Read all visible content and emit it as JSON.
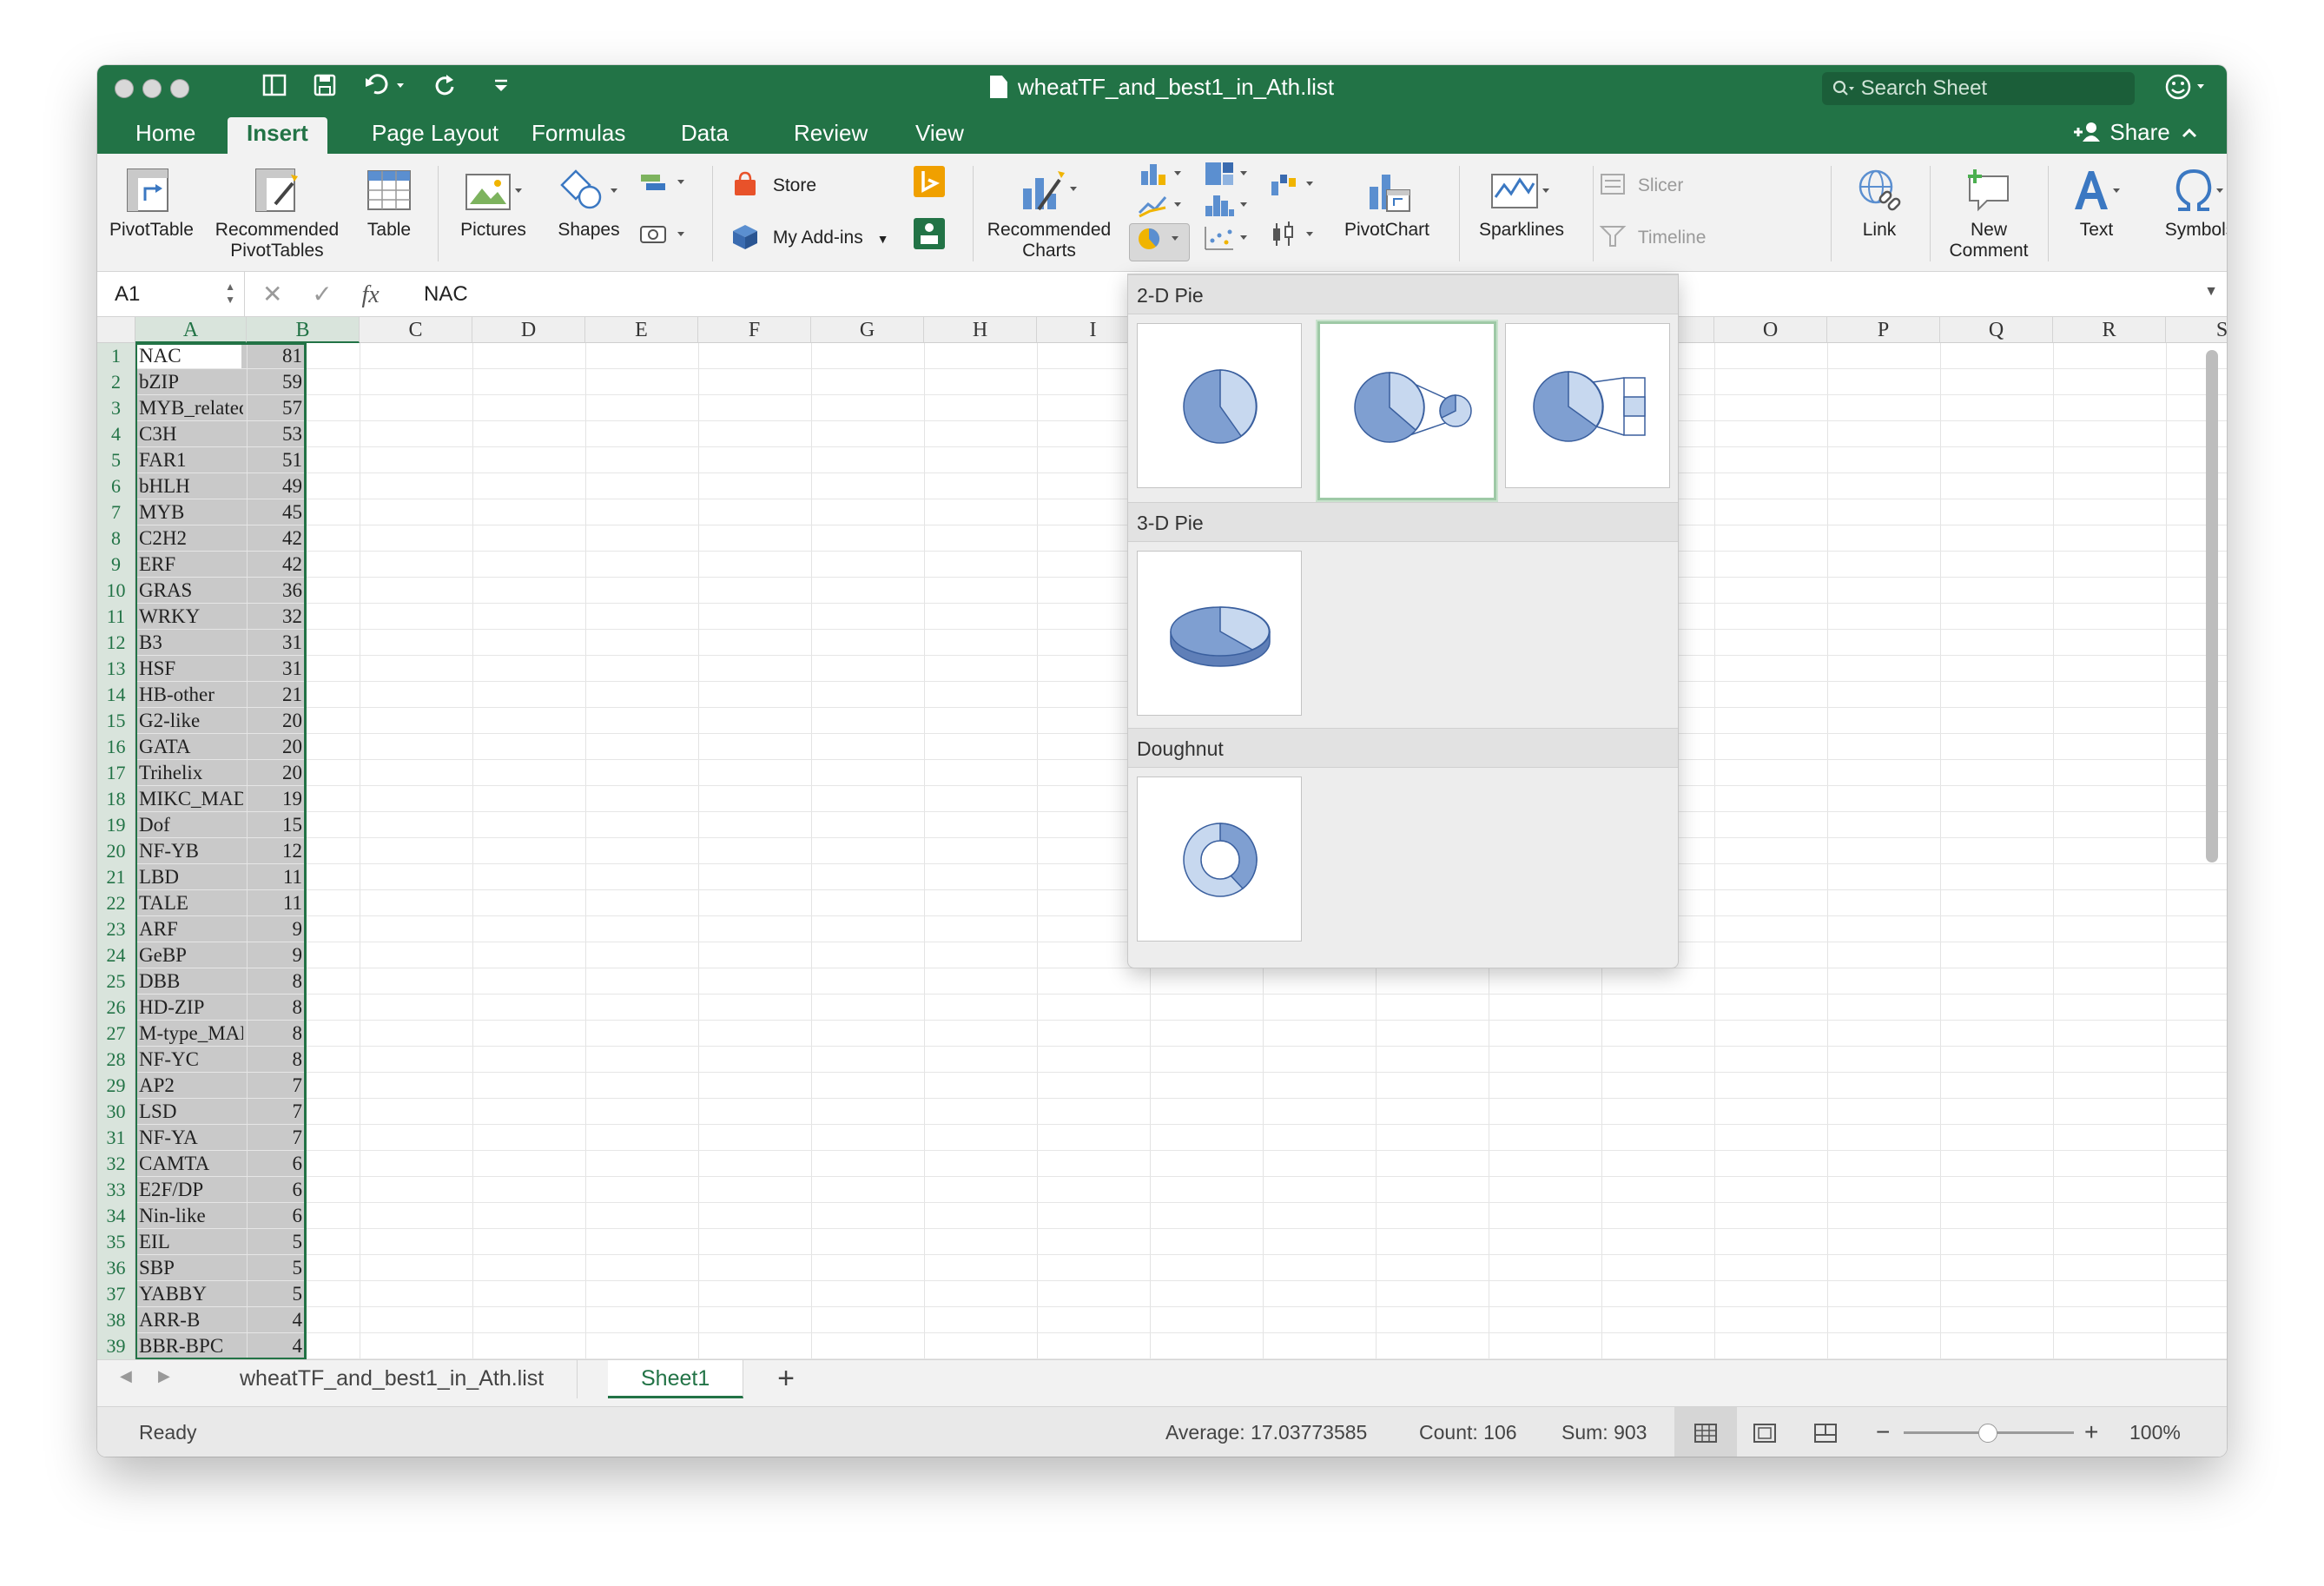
{
  "window": {
    "title": "wheatTF_and_best1_in_Ath.list",
    "search_placeholder": "Search Sheet",
    "share_label": "Share"
  },
  "tabs": [
    "Home",
    "Insert",
    "Page Layout",
    "Formulas",
    "Data",
    "Review",
    "View"
  ],
  "active_tab": "Insert",
  "ribbon": {
    "pivottable": "PivotTable",
    "recommended_pivottables_1": "Recommended",
    "recommended_pivottables_2": "PivotTables",
    "table": "Table",
    "pictures": "Pictures",
    "shapes": "Shapes",
    "store": "Store",
    "my_addins": "My Add-ins",
    "recommended_charts_1": "Recommended",
    "recommended_charts_2": "Charts",
    "pivotchart": "PivotChart",
    "sparklines": "Sparklines",
    "slicer": "Slicer",
    "timeline": "Timeline",
    "link": "Link",
    "new_comment_1": "New",
    "new_comment_2": "Comment",
    "text": "Text",
    "symbols": "Symbols"
  },
  "formula_bar": {
    "name_box": "A1",
    "fx": "fx",
    "value": "NAC"
  },
  "columns": [
    "A",
    "B",
    "C",
    "D",
    "E",
    "F",
    "G",
    "H",
    "I",
    "",
    "",
    "",
    "",
    "",
    "O",
    "P",
    "Q",
    "R",
    "S"
  ],
  "rows": [
    {
      "n": "1",
      "a": "NAC",
      "b": "81"
    },
    {
      "n": "2",
      "a": "bZIP",
      "b": "59"
    },
    {
      "n": "3",
      "a": "MYB_related",
      "b": "57"
    },
    {
      "n": "4",
      "a": "C3H",
      "b": "53"
    },
    {
      "n": "5",
      "a": "FAR1",
      "b": "51"
    },
    {
      "n": "6",
      "a": "bHLH",
      "b": "49"
    },
    {
      "n": "7",
      "a": "MYB",
      "b": "45"
    },
    {
      "n": "8",
      "a": "C2H2",
      "b": "42"
    },
    {
      "n": "9",
      "a": "ERF",
      "b": "42"
    },
    {
      "n": "10",
      "a": "GRAS",
      "b": "36"
    },
    {
      "n": "11",
      "a": "WRKY",
      "b": "32"
    },
    {
      "n": "12",
      "a": "B3",
      "b": "31"
    },
    {
      "n": "13",
      "a": "HSF",
      "b": "31"
    },
    {
      "n": "14",
      "a": "HB-other",
      "b": "21"
    },
    {
      "n": "15",
      "a": "G2-like",
      "b": "20"
    },
    {
      "n": "16",
      "a": "GATA",
      "b": "20"
    },
    {
      "n": "17",
      "a": "Trihelix",
      "b": "20"
    },
    {
      "n": "18",
      "a": "MIKC_MADS",
      "b": "19"
    },
    {
      "n": "19",
      "a": "Dof",
      "b": "15"
    },
    {
      "n": "20",
      "a": "NF-YB",
      "b": "12"
    },
    {
      "n": "21",
      "a": "LBD",
      "b": "11"
    },
    {
      "n": "22",
      "a": "TALE",
      "b": "11"
    },
    {
      "n": "23",
      "a": "ARF",
      "b": "9"
    },
    {
      "n": "24",
      "a": "GeBP",
      "b": "9"
    },
    {
      "n": "25",
      "a": "DBB",
      "b": "8"
    },
    {
      "n": "26",
      "a": "HD-ZIP",
      "b": "8"
    },
    {
      "n": "27",
      "a": "M-type_MADS",
      "b": "8"
    },
    {
      "n": "28",
      "a": "NF-YC",
      "b": "8"
    },
    {
      "n": "29",
      "a": "AP2",
      "b": "7"
    },
    {
      "n": "30",
      "a": "LSD",
      "b": "7"
    },
    {
      "n": "31",
      "a": "NF-YA",
      "b": "7"
    },
    {
      "n": "32",
      "a": "CAMTA",
      "b": "6"
    },
    {
      "n": "33",
      "a": "E2F/DP",
      "b": "6"
    },
    {
      "n": "34",
      "a": "Nin-like",
      "b": "6"
    },
    {
      "n": "35",
      "a": "EIL",
      "b": "5"
    },
    {
      "n": "36",
      "a": "SBP",
      "b": "5"
    },
    {
      "n": "37",
      "a": "YABBY",
      "b": "5"
    },
    {
      "n": "38",
      "a": "ARR-B",
      "b": "4"
    },
    {
      "n": "39",
      "a": "BBR-BPC",
      "b": "4"
    }
  ],
  "pie_menu": {
    "section_2d": "2-D Pie",
    "section_3d": "3-D Pie",
    "section_doughnut": "Doughnut"
  },
  "sheet_tabs": [
    "wheatTF_and_best1_in_Ath.list",
    "Sheet1"
  ],
  "active_sheet": "Sheet1",
  "add_sheet": "+",
  "status": {
    "ready": "Ready",
    "average": "Average: 17.03773585",
    "count": "Count: 106",
    "sum": "Sum: 903",
    "zoom": "100%"
  },
  "colors": {
    "brand_green": "#227346",
    "pie_blue": "#7f9fd1",
    "pie_light": "#c7d8ef"
  }
}
